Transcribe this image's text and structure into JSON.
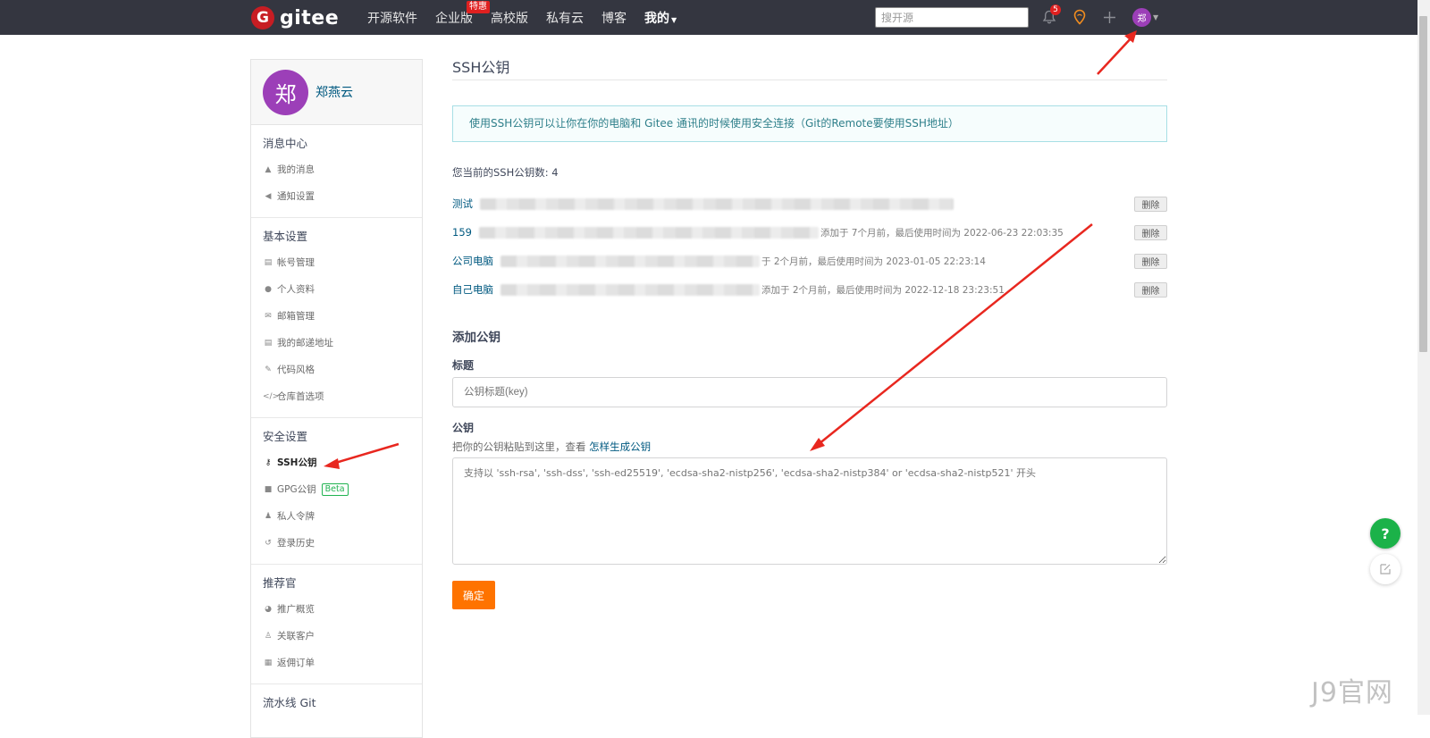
{
  "topnav": {
    "logo_text": "gitee",
    "logo_mark": "G",
    "items": [
      {
        "label": "开源软件"
      },
      {
        "label": "企业版",
        "badge": "特惠"
      },
      {
        "label": "高校版"
      },
      {
        "label": "私有云"
      },
      {
        "label": "博客"
      },
      {
        "label": "我的"
      }
    ],
    "search_placeholder": "搜开源",
    "notification_count": "5",
    "avatar_initial": "郑"
  },
  "sidebar": {
    "avatar_initial": "郑",
    "user_name": "郑燕云",
    "sections": [
      {
        "title": "消息中心",
        "items": [
          {
            "label": "我的消息",
            "icon": "bell-icon"
          },
          {
            "label": "通知设置",
            "icon": "speaker-icon"
          }
        ]
      },
      {
        "title": "基本设置",
        "items": [
          {
            "label": "帐号管理",
            "icon": "id-card-icon"
          },
          {
            "label": "个人资料",
            "icon": "user-icon"
          },
          {
            "label": "邮箱管理",
            "icon": "mail-icon"
          },
          {
            "label": "我的邮递地址",
            "icon": "address-card-icon"
          },
          {
            "label": "代码风格",
            "icon": "brush-icon"
          },
          {
            "label": "仓库首选项",
            "icon": "code-icon"
          }
        ]
      },
      {
        "title": "安全设置",
        "items": [
          {
            "label": "SSH公钥",
            "icon": "key-icon",
            "active": true
          },
          {
            "label": "GPG公钥",
            "icon": "lock-icon",
            "badge": "Beta"
          },
          {
            "label": "私人令牌",
            "icon": "user-secret-icon"
          },
          {
            "label": "登录历史",
            "icon": "history-icon"
          }
        ]
      },
      {
        "title": "推荐官",
        "items": [
          {
            "label": "推广概览",
            "icon": "chart-icon"
          },
          {
            "label": "关联客户",
            "icon": "users-icon"
          },
          {
            "label": "返佣订单",
            "icon": "list-icon"
          }
        ]
      },
      {
        "title": "流水线 Git",
        "items": []
      }
    ]
  },
  "main": {
    "title": "SSH公钥",
    "info": "使用SSH公钥可以让你在你的电脑和 Gitee 通讯的时候使用安全连接（Git的Remote要使用SSH地址）",
    "key_count": "您当前的SSH公钥数: 4",
    "keys": [
      {
        "title": "测试",
        "meta": "",
        "delete": "删除"
      },
      {
        "title": "159",
        "meta": "添加于 7个月前，最后使用时间为 2022-06-23 22:03:35",
        "delete": "删除"
      },
      {
        "title": "公司电脑",
        "meta": "于 2个月前，最后使用时间为 2023-01-05 22:23:14",
        "delete": "删除"
      },
      {
        "title": "自己电脑",
        "meta": "添加于 2个月前，最后使用时间为 2022-12-18 23:23:51",
        "delete": "删除"
      }
    ],
    "add_title": "添加公钥",
    "label_title": "标题",
    "title_placeholder": "公钥标题(key)",
    "label_key": "公钥",
    "hint_prefix": "把你的公钥粘贴到这里，查看 ",
    "hint_link": "怎样生成公钥",
    "key_placeholder": "支持以 'ssh-rsa', 'ssh-dss', 'ssh-ed25519', 'ecdsa-sha2-nistp256', 'ecdsa-sha2-nistp384' or 'ecdsa-sha2-nistp521' 开头",
    "submit": "确定"
  },
  "floating": {
    "help": "?",
    "feedback_icon": "edit-icon"
  },
  "watermark": "J9官网",
  "colors": {
    "topbar": "#343640",
    "brand_red": "#c71d23",
    "submit_orange": "#fe7300",
    "help_green": "#1bb249",
    "link_blue": "#005980",
    "annotation_red": "#e8271f"
  }
}
